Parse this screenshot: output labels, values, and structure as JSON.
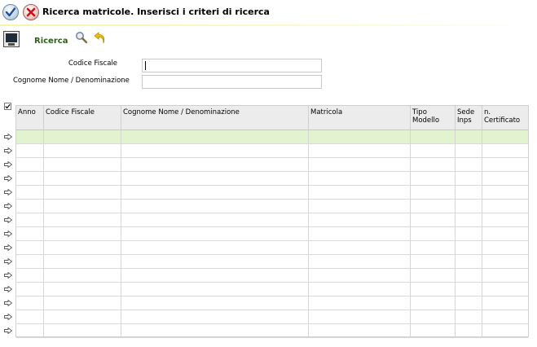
{
  "window": {
    "title": "Ricerca matricole. Inserisci i criteri di ricerca",
    "confirm_icon": "checkmark-icon",
    "cancel_icon": "close-icon"
  },
  "toolbar": {
    "section_label": "Ricerca",
    "icons": [
      "monitor-icon",
      "search-icon",
      "undo-icon"
    ]
  },
  "form": {
    "codice_fiscale": {
      "label": "Codice Fiscale",
      "value": ""
    },
    "cognome_nome": {
      "label": "Cognome Nome / Denominazione",
      "value": ""
    }
  },
  "grid": {
    "select_all_icon": "checkmark-icon",
    "row_icon": "arrow-right-icon",
    "columns": [
      "Anno",
      "Codice Fiscale",
      "Cognome Nome / Denominazione",
      "Matricola",
      "Tipo Modello",
      "Sede Inps",
      "n. Certificato"
    ],
    "row_count": 15,
    "selected_row": 0
  },
  "colors": {
    "title_underline": "#f4f4a8",
    "selected_row": "#e2f4cf",
    "section_label": "#2b5e1b",
    "header_bg": "#ececec"
  }
}
